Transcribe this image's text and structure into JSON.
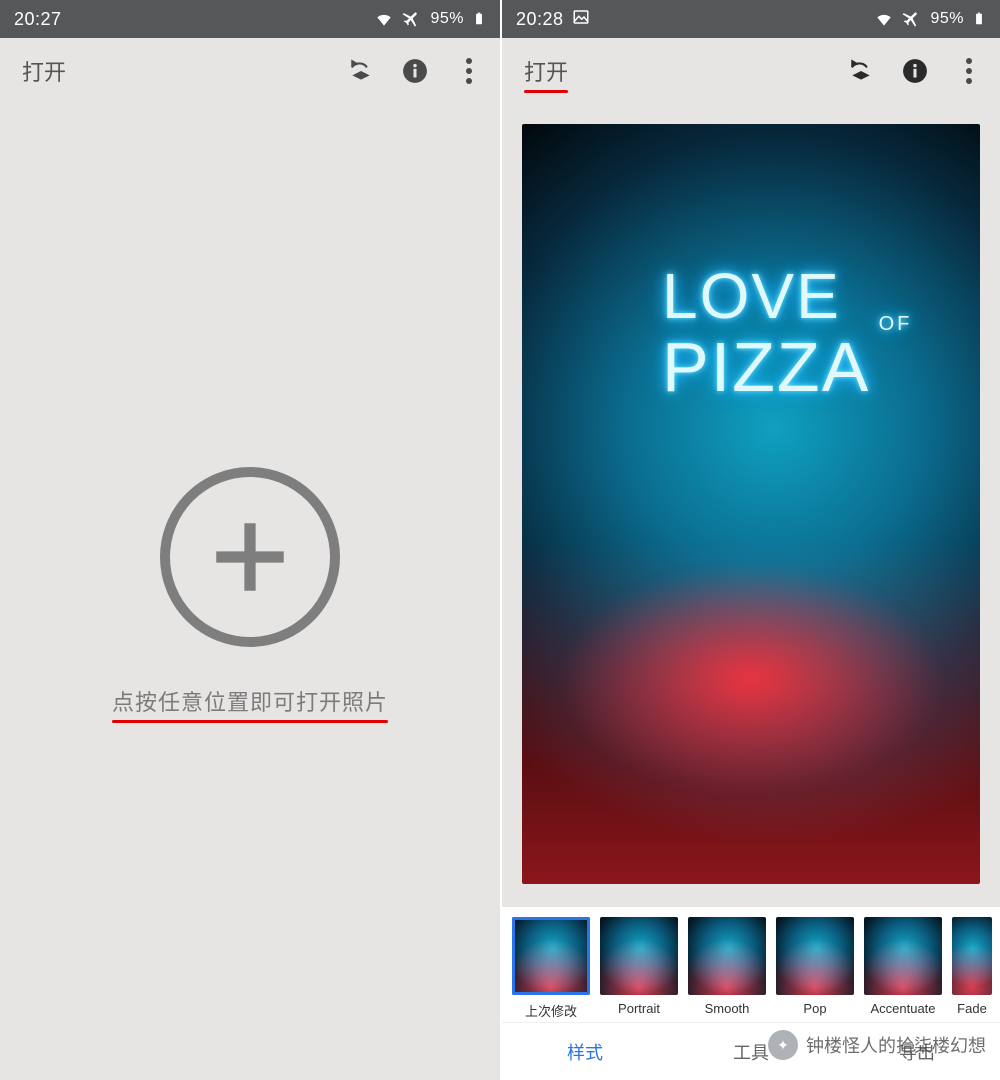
{
  "left": {
    "status": {
      "time": "20:27",
      "battery": "95%"
    },
    "appbar": {
      "open": "打开"
    },
    "hint": "点按任意位置即可打开照片"
  },
  "right": {
    "status": {
      "time": "20:28",
      "battery": "95%"
    },
    "appbar": {
      "open": "打开"
    },
    "photo_neon": {
      "line1": "LOVE",
      "of": "OF",
      "line2": "PIZZA"
    },
    "filters": [
      {
        "label": "上次修改",
        "selected": true
      },
      {
        "label": "Portrait"
      },
      {
        "label": "Smooth"
      },
      {
        "label": "Pop"
      },
      {
        "label": "Accentuate"
      },
      {
        "label": "Fade"
      }
    ],
    "tabs": {
      "styles": "样式",
      "tools": "工具",
      "export": "导出"
    }
  },
  "watermark": "钟楼怪人的拾柒楼幻想",
  "icons": {
    "wifi": "wifi-icon",
    "airplane": "airplane-icon",
    "battery": "battery-icon",
    "image": "image-icon",
    "layers": "layers-undo-icon",
    "info": "info-icon",
    "more": "more-vert-icon",
    "plus": "plus-circle-icon",
    "wechat": "wechat-icon"
  }
}
